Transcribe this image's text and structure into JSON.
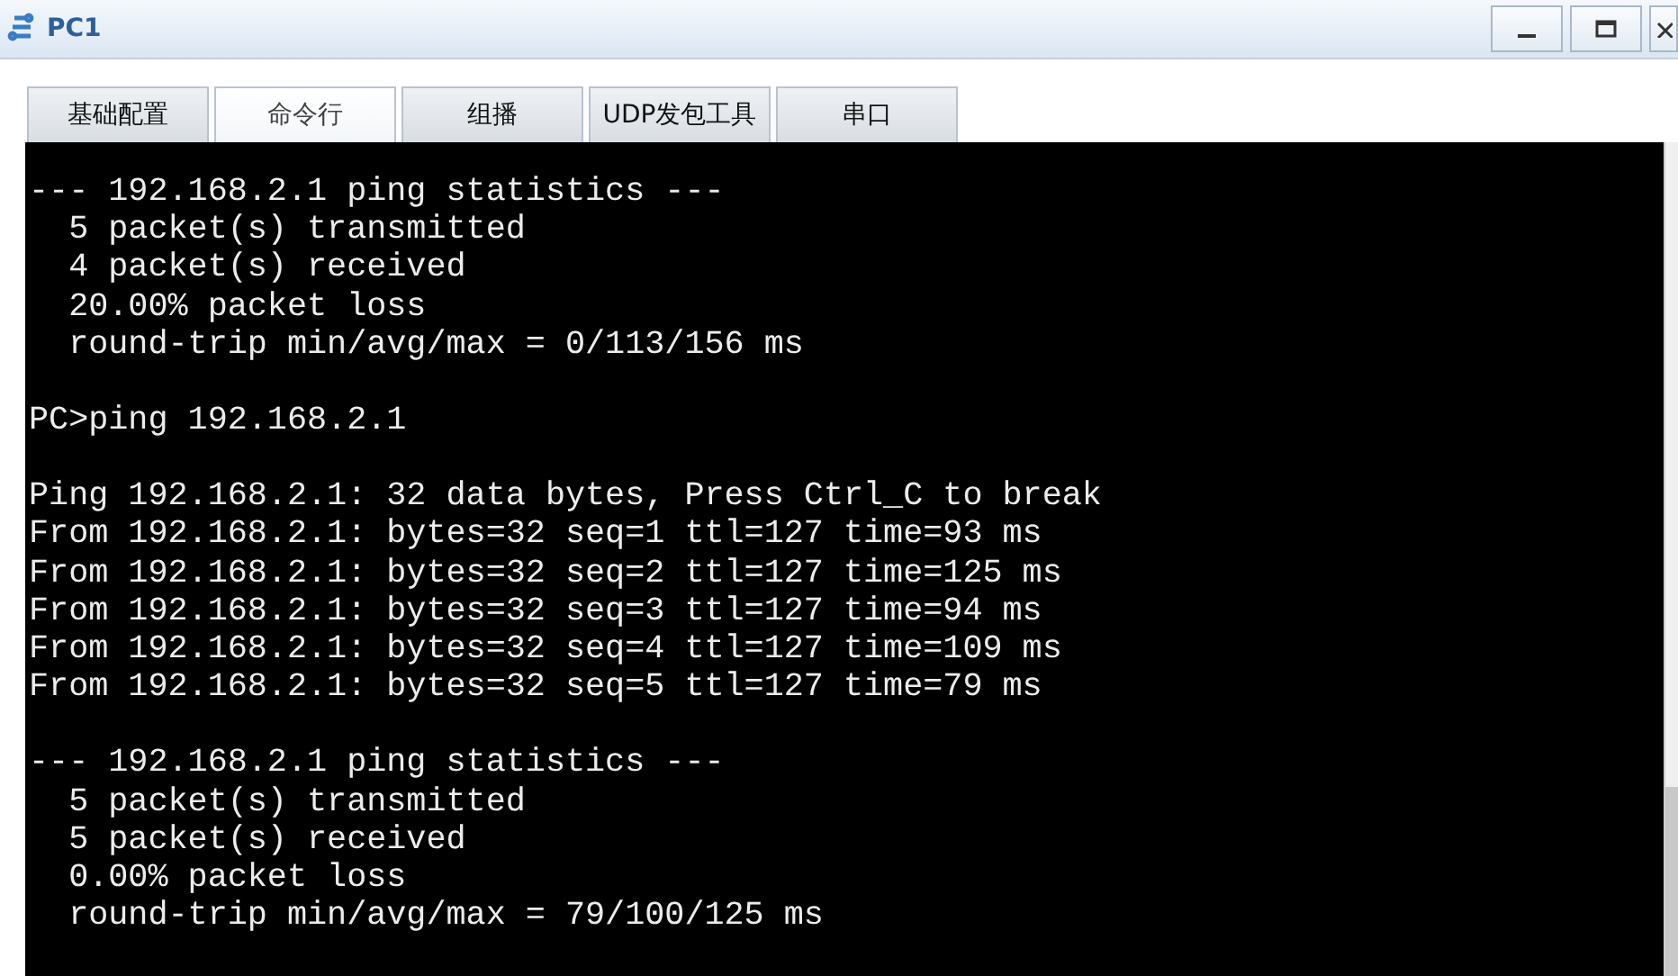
{
  "window": {
    "title": "PC1"
  },
  "tabs": [
    {
      "label": "基础配置",
      "selected": false
    },
    {
      "label": "命令行",
      "selected": true
    },
    {
      "label": "组播",
      "selected": false
    },
    {
      "label": "UDP发包工具",
      "selected": false
    },
    {
      "label": "串口",
      "selected": false
    }
  ],
  "terminal": {
    "blocks": [
      [
        "--- 192.168.2.1 ping statistics ---",
        "  5 packet(s) transmitted",
        "  4 packet(s) received",
        "  20.00% packet loss",
        "  round-trip min/avg/max = 0/113/156 ms"
      ],
      [
        "PC>ping 192.168.2.1"
      ],
      [
        "Ping 192.168.2.1: 32 data bytes, Press Ctrl_C to break",
        "From 192.168.2.1: bytes=32 seq=1 ttl=127 time=93 ms",
        "From 192.168.2.1: bytes=32 seq=2 ttl=127 time=125 ms",
        "From 192.168.2.1: bytes=32 seq=3 ttl=127 time=94 ms",
        "From 192.168.2.1: bytes=32 seq=4 ttl=127 time=109 ms",
        "From 192.168.2.1: bytes=32 seq=5 ttl=127 time=79 ms"
      ],
      [
        "--- 192.168.2.1 ping statistics ---",
        "  5 packet(s) transmitted",
        "  5 packet(s) received",
        "  0.00% packet loss",
        "  round-trip min/avg/max = 79/100/125 ms"
      ]
    ]
  }
}
